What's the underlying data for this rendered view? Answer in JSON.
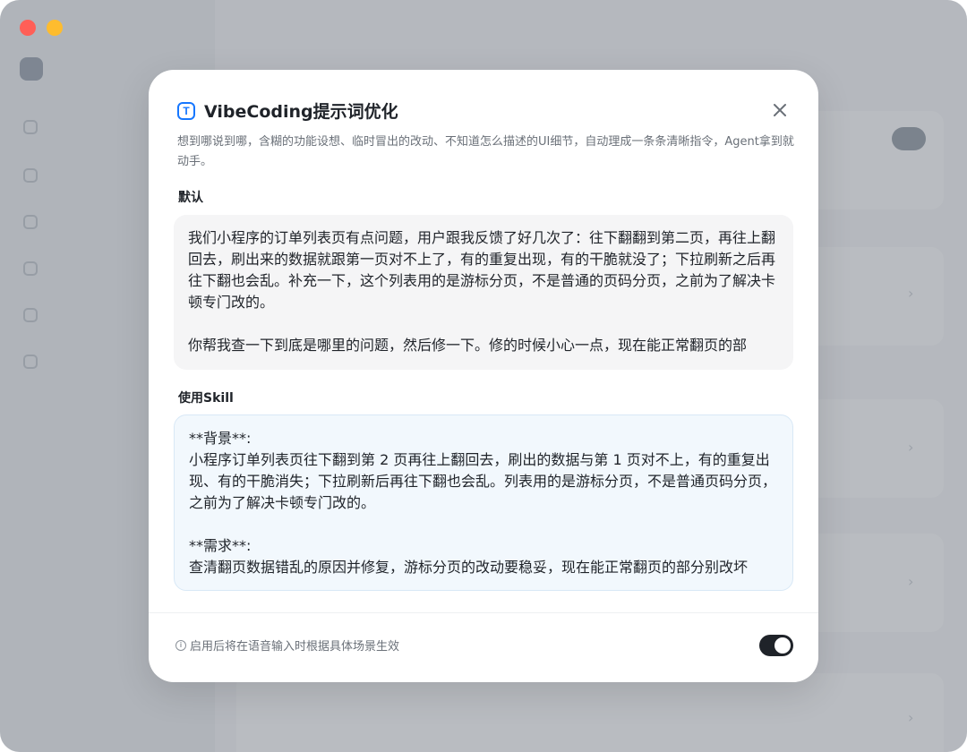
{
  "modal": {
    "title": "VibeCoding提示词优化",
    "description": "想到哪说到哪，含糊的功能设想、临时冒出的改动、不知道怎么描述的UI细节，自动理成一条条清晰指令，Agent拿到就动手。",
    "sections": {
      "default": {
        "label": "默认",
        "content": "我们小程序的订单列表页有点问题，用户跟我反馈了好几次了：往下翻翻到第二页，再往上翻回去，刷出来的数据就跟第一页对不上了，有的重复出现，有的干脆就没了；下拉刷新之后再往下翻也会乱。补充一下，这个列表用的是游标分页，不是普通的页码分页，之前为了解决卡顿专门改的。\n\n你帮我查一下到底是哪里的问题，然后修一下。修的时候小心一点，现在能正常翻页的部"
      },
      "skill": {
        "label": "使用Skill",
        "content": "**背景**:\n小程序订单列表页往下翻到第 2 页再往上翻回去，刷出的数据与第 1 页对不上，有的重复出现、有的干脆消失；下拉刷新后再往下翻也会乱。列表用的是游标分页，不是普通页码分页，之前为了解决卡顿专门改的。\n\n**需求**:\n查清翻页数据错乱的原因并修复，游标分页的改动要稳妥，现在能正常翻页的部分别改坏"
      }
    },
    "footer": {
      "note": "启用后将在语音输入时根据具体场景生效",
      "toggle_on": true
    }
  }
}
